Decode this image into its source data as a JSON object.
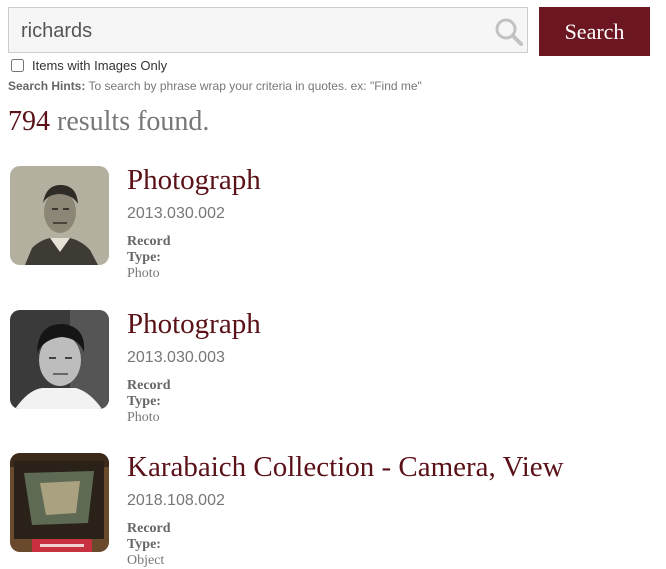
{
  "search": {
    "value": "richards",
    "button_label": "Search",
    "icon": "search-icon"
  },
  "filters": {
    "images_only_label": "Items with Images Only",
    "images_only_checked": false
  },
  "hints": {
    "label": "Search Hints:",
    "text": "To search by phrase wrap your criteria in quotes. ex: \"Find me\""
  },
  "results": {
    "count": "794",
    "suffix": "results found.",
    "record_type_label": "Record Type:",
    "items": [
      {
        "title": "Photograph",
        "id": "2013.030.002",
        "type": "Photo"
      },
      {
        "title": "Photograph",
        "id": "2013.030.003",
        "type": "Photo"
      },
      {
        "title": "Karabaich Collection - Camera, View",
        "id": "2018.108.002",
        "type": "Object"
      }
    ]
  },
  "colors": {
    "accent": "#6b1620",
    "title": "#5a1218",
    "muted": "#777777"
  }
}
